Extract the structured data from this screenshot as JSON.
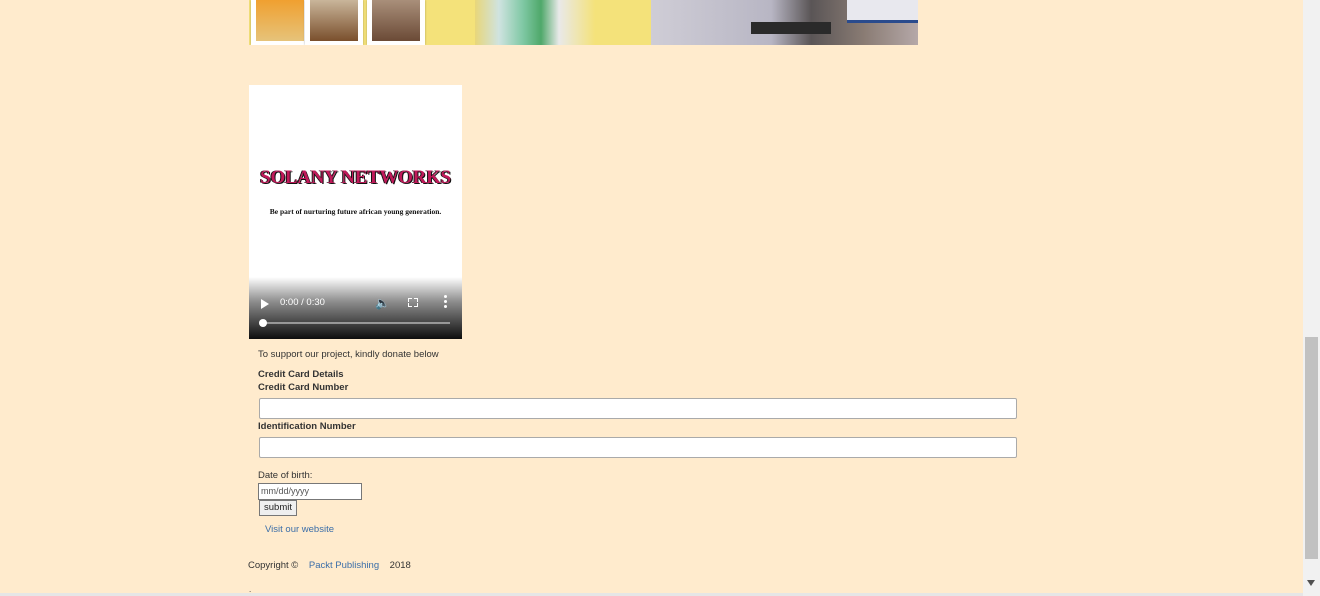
{
  "video": {
    "title": "SOLANY NETWORKS",
    "subtitle": "Be part of nurturing future african young generation.",
    "time": "0:00 / 0:30"
  },
  "form": {
    "donate_text": "To support our project, kindly donate below",
    "section_title": "Credit Card Details",
    "card_number_label": "Credit Card Number",
    "id_number_label": "Identification Number",
    "dob_label": "Date of birth:",
    "dob_placeholder": "mm/dd/yyyy",
    "submit_label": "submit"
  },
  "links": {
    "visit": "Visit our website"
  },
  "footer": {
    "copyright": "Copyright ©",
    "publisher": "Packt Publishing",
    "year": "2018",
    "dot": "."
  },
  "colors": {
    "background": "#ffebcd",
    "link": "#3b6ea8",
    "video_title": "#c01a5a"
  }
}
